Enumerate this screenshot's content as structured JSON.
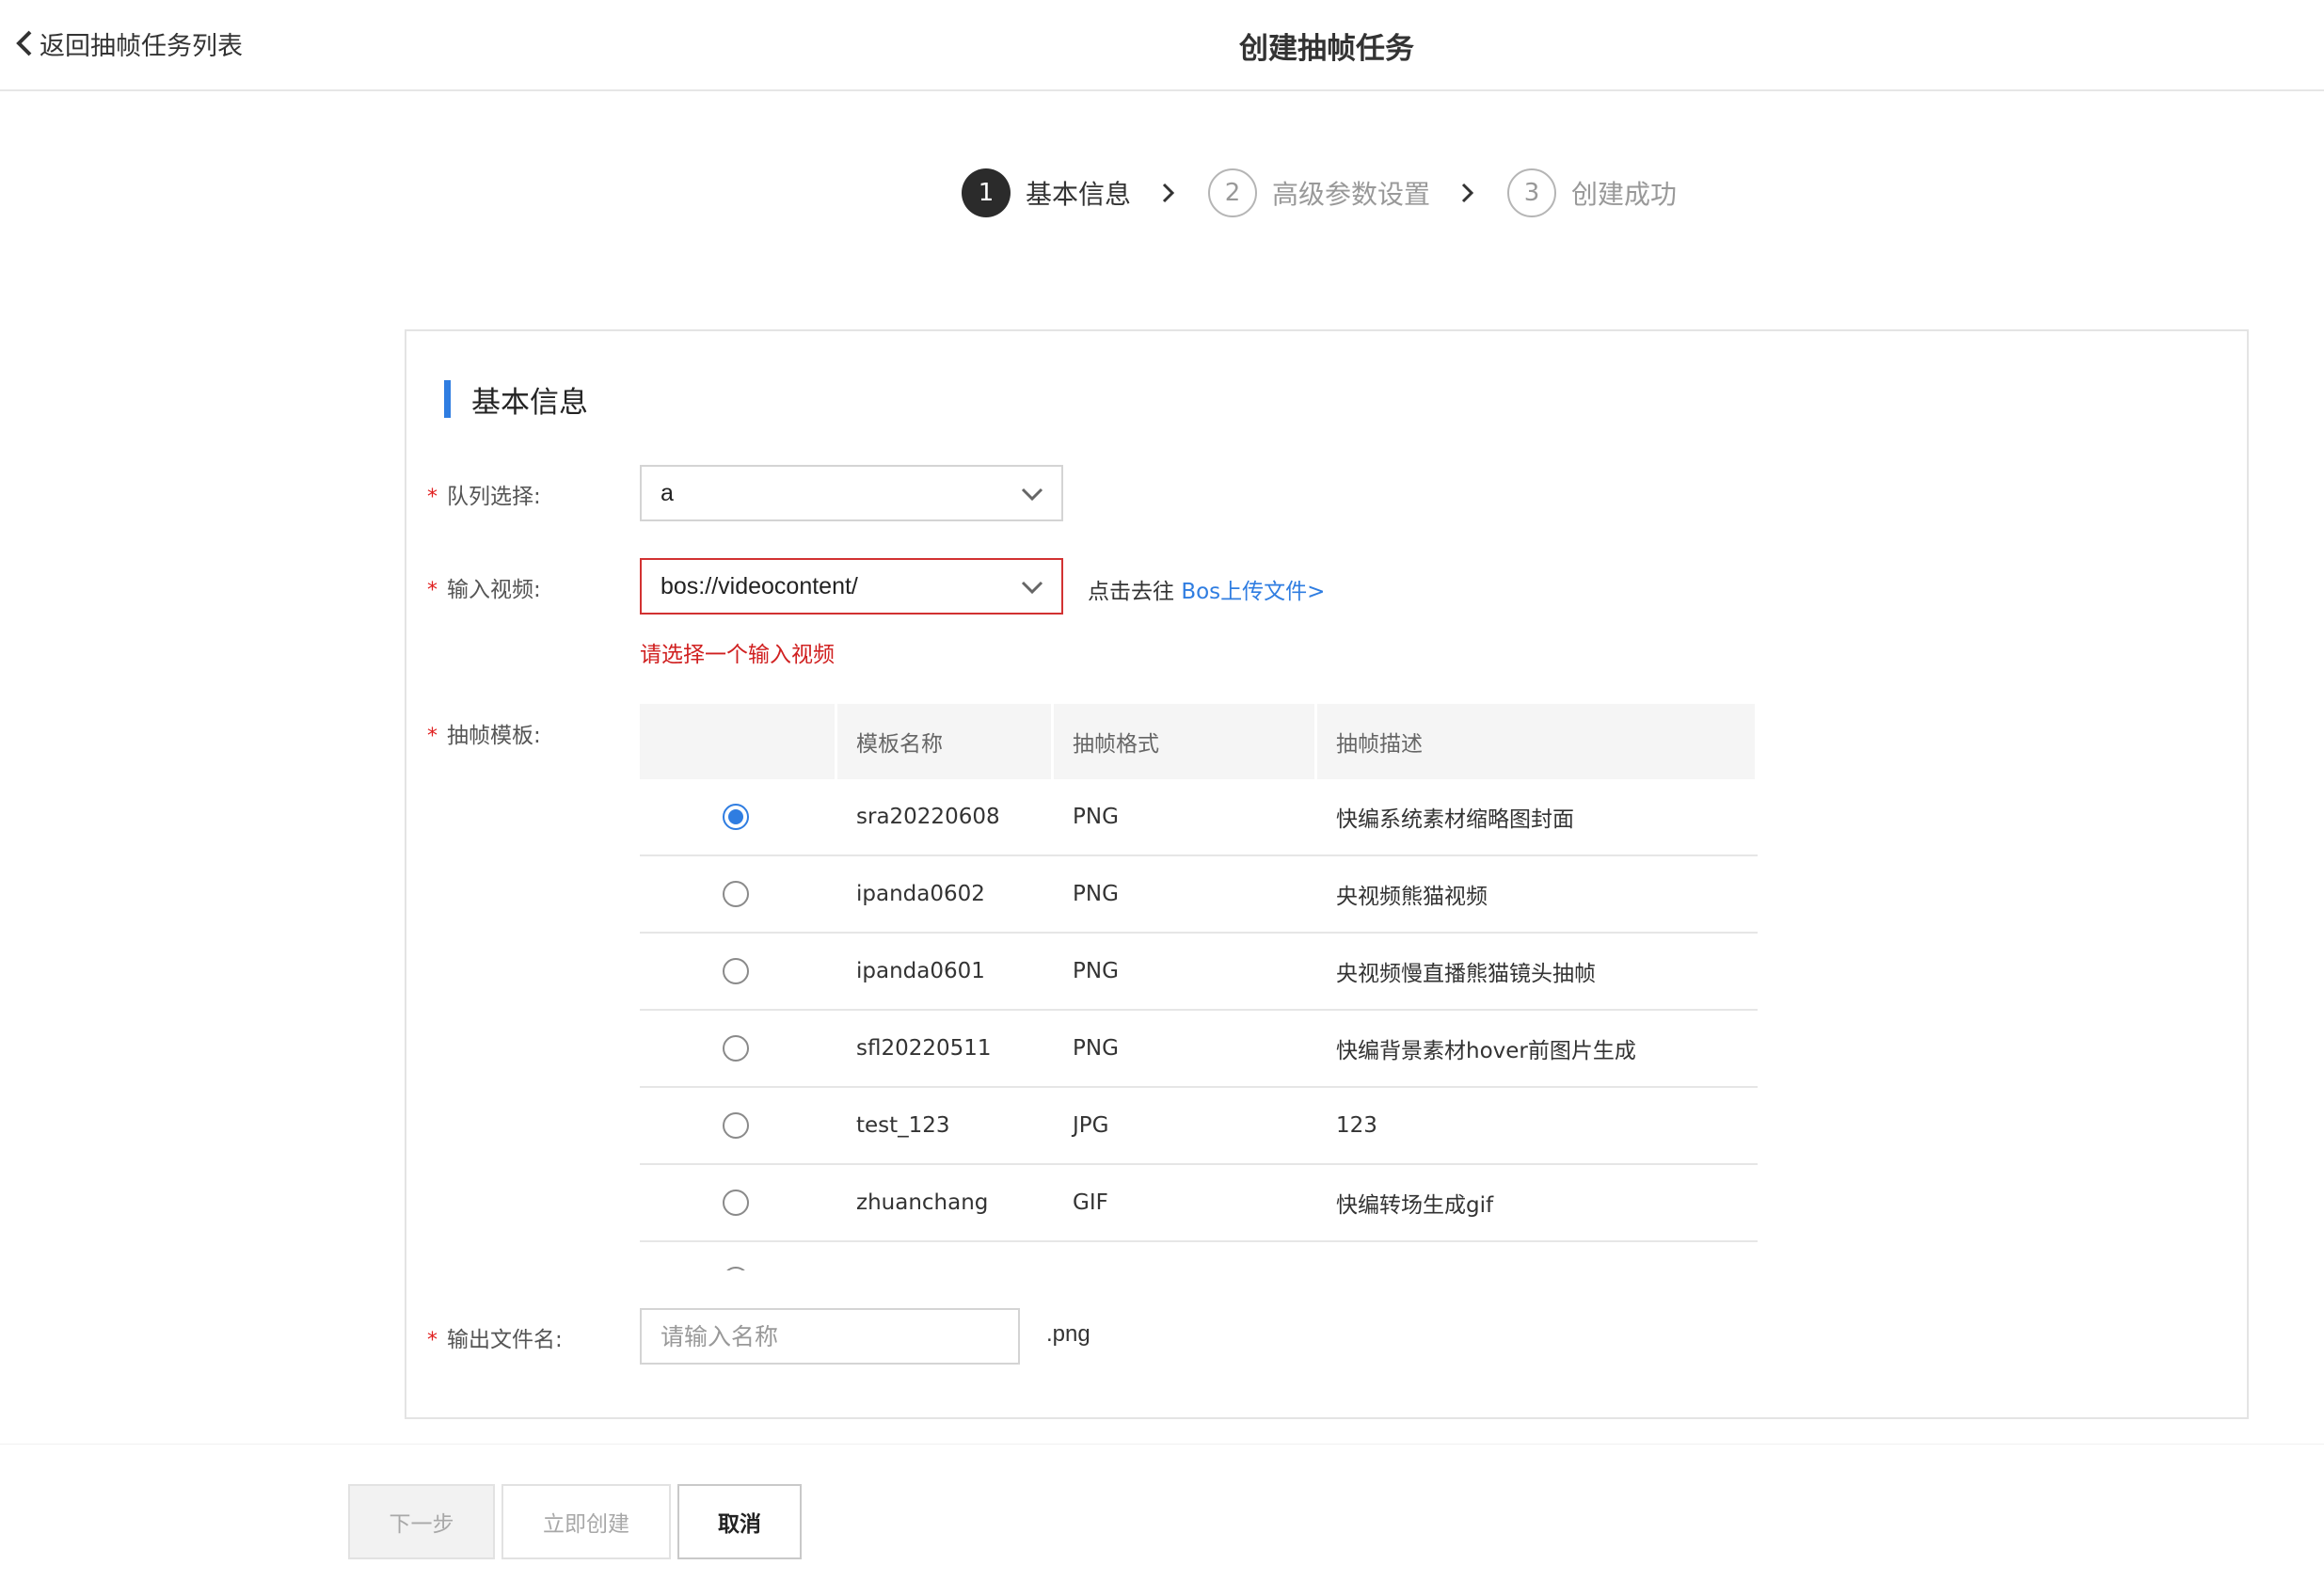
{
  "header": {
    "back_label": "返回抽帧任务列表",
    "title": "创建抽帧任务"
  },
  "steps": [
    {
      "num": "1",
      "label": "基本信息",
      "active": true
    },
    {
      "num": "2",
      "label": "高级参数设置",
      "active": false
    },
    {
      "num": "3",
      "label": "创建成功",
      "active": false
    }
  ],
  "section": {
    "title": "基本信息"
  },
  "form": {
    "queue": {
      "label": "队列选择:",
      "value": "a"
    },
    "video": {
      "label": "输入视频:",
      "value": "bos://videocontent/",
      "hint_prefix": "点击去往",
      "hint_link": "Bos上传文件>",
      "error": "请选择一个输入视频"
    },
    "template": {
      "label": "抽帧模板:",
      "columns": [
        "",
        "模板名称",
        "抽帧格式",
        "抽帧描述"
      ],
      "rows": [
        {
          "name": "sra20220608",
          "format": "PNG",
          "desc": "快编系统素材缩略图封面",
          "checked": true
        },
        {
          "name": "ipanda0602",
          "format": "PNG",
          "desc": "央视频熊猫视频",
          "checked": false
        },
        {
          "name": "ipanda0601",
          "format": "PNG",
          "desc": "央视频慢直播熊猫镜头抽帧",
          "checked": false
        },
        {
          "name": "sfl20220511",
          "format": "PNG",
          "desc": "快编背景素材hover前图片生成",
          "checked": false
        },
        {
          "name": "test_123",
          "format": "JPG",
          "desc": "123",
          "checked": false
        },
        {
          "name": "zhuanchang",
          "format": "GIF",
          "desc": "快编转场生成gif",
          "checked": false
        }
      ]
    },
    "output": {
      "label": "输出文件名:",
      "value": "",
      "placeholder": "请输入名称",
      "suffix": ".png"
    }
  },
  "footer": {
    "next_label": "下一步",
    "create_label": "立即创建",
    "cancel_label": "取消"
  },
  "colors": {
    "accent": "#2f7de1",
    "error": "#d02020",
    "required": "#e02020"
  }
}
